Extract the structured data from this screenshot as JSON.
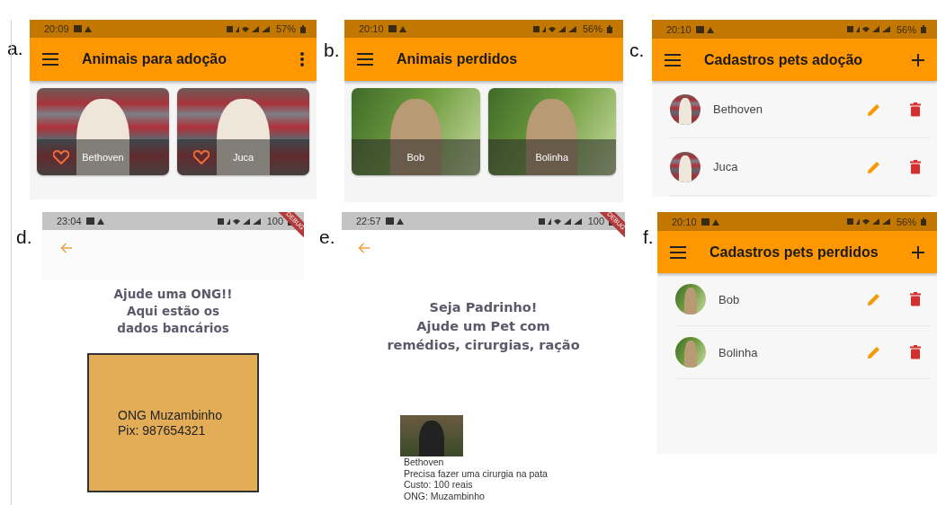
{
  "panels": [
    {
      "letter": "a.",
      "kind": "cards",
      "status_bar": {
        "time": "20:09",
        "battery": "57%"
      },
      "app_bar": {
        "title": "Animais para adoção",
        "more_button": true
      },
      "items": [
        {
          "name": "Bethoven",
          "favorite_icon": true
        },
        {
          "name": "Juca",
          "favorite_icon": true
        }
      ]
    },
    {
      "letter": "b.",
      "kind": "cards",
      "status_bar": {
        "time": "20:10",
        "battery": "56%"
      },
      "app_bar": {
        "title": "Animais perdidos"
      },
      "items": [
        {
          "name": "Bob",
          "favorite_icon": false
        },
        {
          "name": "Bolinha",
          "favorite_icon": false
        }
      ]
    },
    {
      "letter": "c.",
      "kind": "list",
      "status_bar": {
        "time": "20:10",
        "battery": "56%"
      },
      "app_bar": {
        "title": "Cadastros pets adoção",
        "add_button": true
      },
      "items": [
        {
          "name": "Bethoven"
        },
        {
          "name": "Juca"
        }
      ]
    },
    {
      "letter": "d.",
      "kind": "donation",
      "status_bar": {
        "time": "23:04",
        "battery": "100"
      },
      "debug_banner": "DEBUG",
      "heading_lines": [
        "Ajude uma ONG!!",
        "Aqui estão os",
        "dados bancários"
      ],
      "bank_lines": [
        "ONG Muzambinho",
        "Pix: 987654321"
      ]
    },
    {
      "letter": "e.",
      "kind": "sponsor",
      "status_bar": {
        "time": "22:57",
        "battery": "100"
      },
      "debug_banner": "DEBUG",
      "heading_lines": [
        "Seja Padrinho!",
        "Ajude um Pet com",
        "remédios, cirurgias, ração"
      ],
      "sponsor": {
        "lines": [
          "Bethoven",
          "Precisa fazer uma cirurgia na pata",
          "Custo: 100 reais",
          "ONG: Muzambinho"
        ]
      }
    },
    {
      "letter": "f.",
      "kind": "list",
      "status_bar": {
        "time": "20:10",
        "battery": "56%"
      },
      "app_bar": {
        "title": "Cadastros pets perdidos",
        "add_button": true
      },
      "items": [
        {
          "name": "Bob"
        },
        {
          "name": "Bolinha"
        }
      ]
    }
  ]
}
